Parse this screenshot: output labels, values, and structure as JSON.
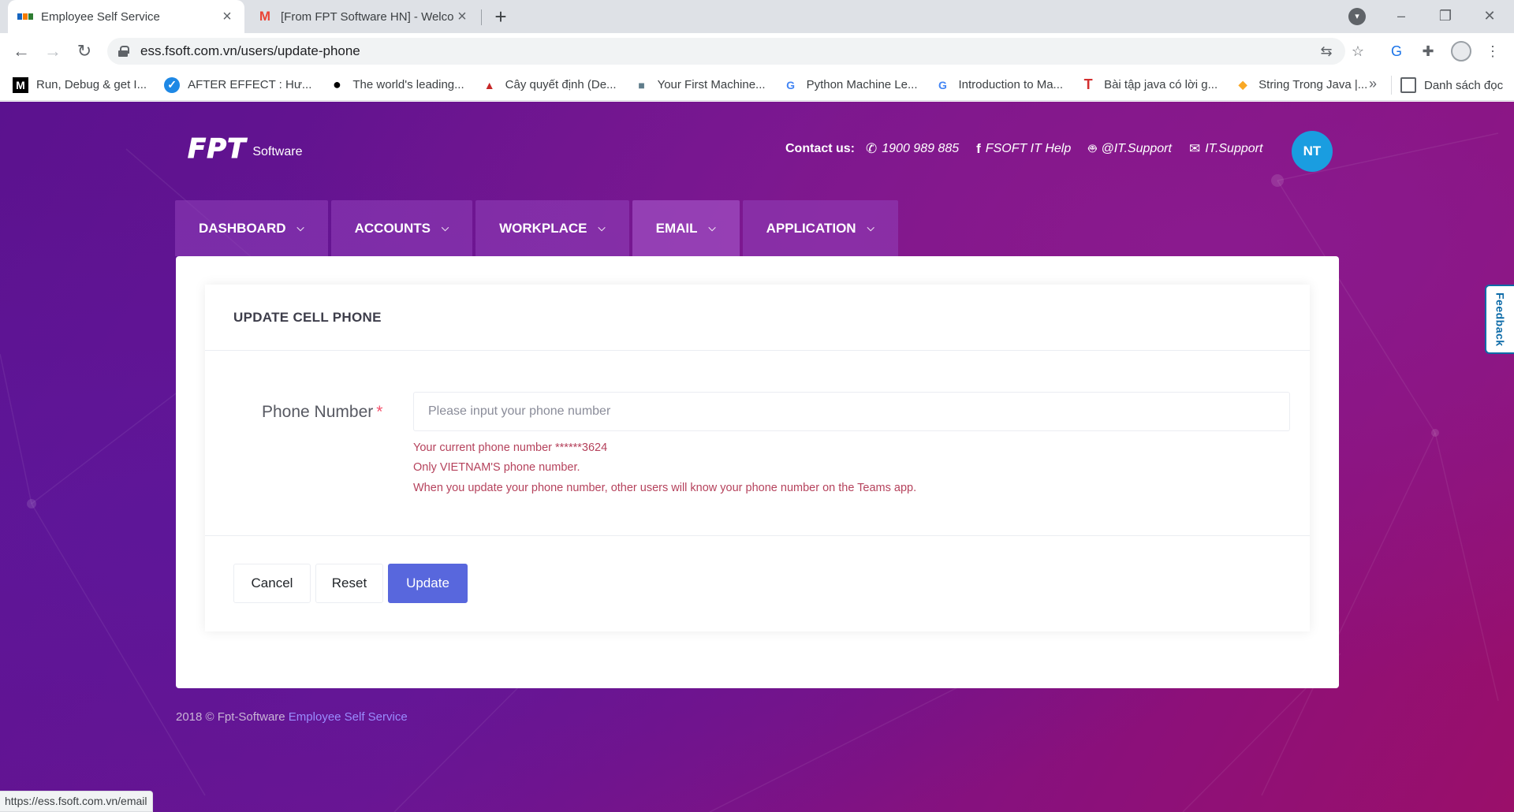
{
  "browser": {
    "tabs": [
      {
        "title": "Employee Self Service",
        "active": true
      },
      {
        "title": "[From FPT Software HN] - Welcome",
        "active": false
      }
    ],
    "url": "ess.fsoft.com.vn/users/update-phone",
    "bookmarks": [
      {
        "label": "Run, Debug & get I...",
        "icon": "M"
      },
      {
        "label": "AFTER EFFECT : Hư...",
        "icon": "✓"
      },
      {
        "label": "The world's leading...",
        "icon": "●"
      },
      {
        "label": "Cây quyết định (De...",
        "icon": "▲"
      },
      {
        "label": "Your First Machine...",
        "icon": "■"
      },
      {
        "label": "Python Machine Le...",
        "icon": "G"
      },
      {
        "label": "Introduction to Ma...",
        "icon": "G"
      },
      {
        "label": "Bài tập java có lời g...",
        "icon": "T"
      },
      {
        "label": "String Trong Java |...",
        "icon": "◆"
      }
    ],
    "bookmarks_more": "»",
    "reading_list": "Danh sách đọc",
    "status_url": "https://ess.fsoft.com.vn/email"
  },
  "header": {
    "logo_text": "FPT",
    "logo_sub": "Software",
    "contact_label": "Contact us:",
    "phone": "1900 989 885",
    "facebook": "FSOFT IT Help",
    "bot": "@IT.Support",
    "mail": "IT.Support",
    "avatar_initials": "NT"
  },
  "nav": {
    "items": [
      "DASHBOARD",
      "ACCOUNTS",
      "WORKPLACE",
      "EMAIL",
      "APPLICATION"
    ]
  },
  "form": {
    "title": "UPDATE CELL PHONE",
    "phone_label": "Phone Number",
    "required_mark": "*",
    "phone_placeholder": "Please input your phone number",
    "phone_value": "",
    "help": [
      "Your current phone number ******3624",
      "Only VIETNAM'S phone number.",
      "When you update your phone number, other users will know your phone number on the Teams app."
    ],
    "cancel_label": "Cancel",
    "reset_label": "Reset",
    "update_label": "Update"
  },
  "footer": {
    "text": "2018 © Fpt-Software",
    "link": "Employee Self Service"
  },
  "feedback_label": "Feedback",
  "colors": {
    "primary_button": "#5867dd",
    "avatar": "#1a9de0",
    "required": "#f4516c",
    "help_text": "#b5425c"
  }
}
